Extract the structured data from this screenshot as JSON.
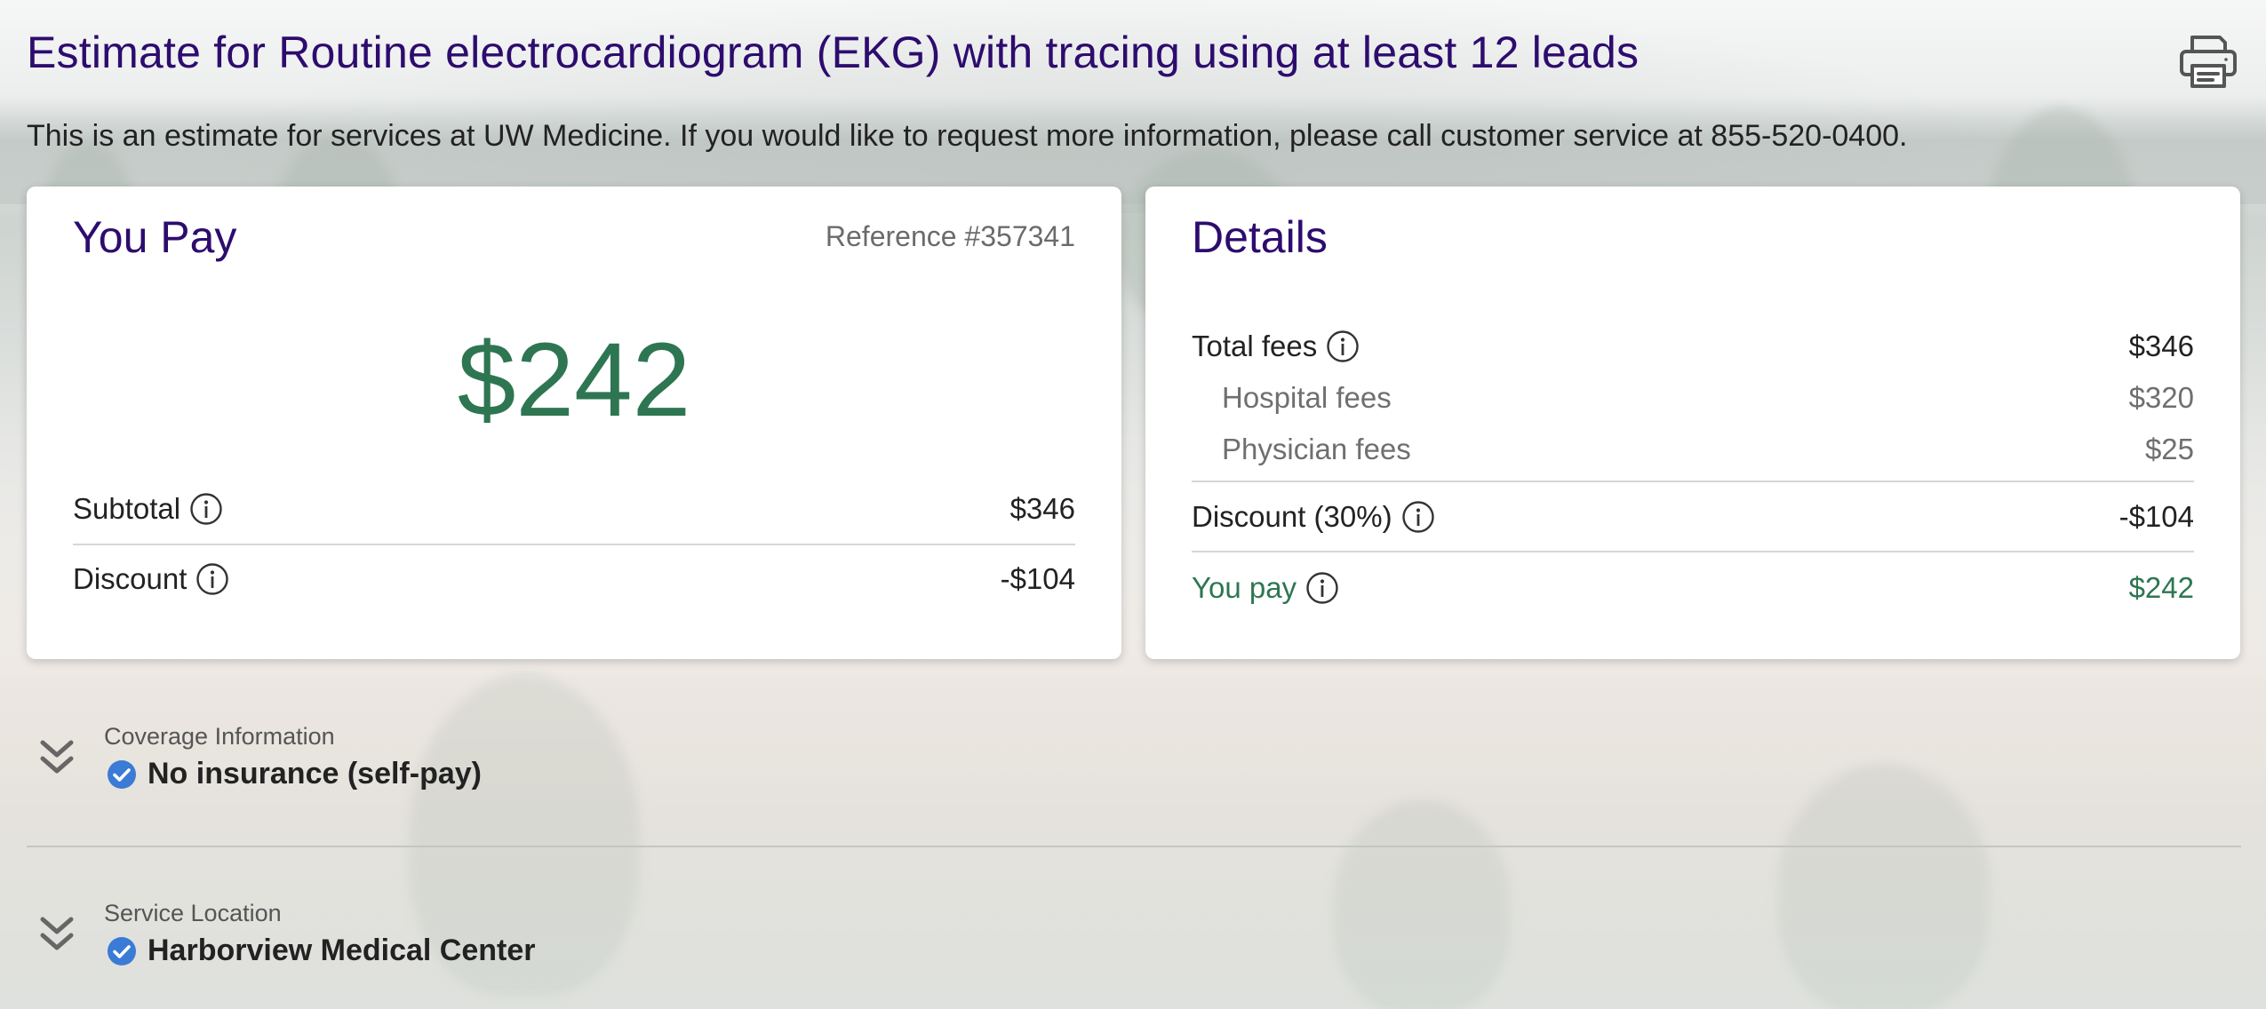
{
  "page": {
    "title": "Estimate for Routine electrocardiogram (EKG) with tracing using at least 12 leads",
    "intro": "This is an estimate for services at UW Medicine. If you would like to request more information, please call customer service at 855-520-0400.",
    "print_icon": "printer-icon"
  },
  "you_pay": {
    "heading": "You Pay",
    "reference": "Reference #357341",
    "amount": "$242",
    "rows": [
      {
        "label": "Subtotal",
        "value": "$346"
      },
      {
        "label": "Discount",
        "value": "-$104"
      }
    ]
  },
  "details": {
    "heading": "Details",
    "total_fees": {
      "label": "Total fees",
      "value": "$346"
    },
    "hospital_fees": {
      "label": "Hospital fees",
      "value": "$320"
    },
    "physician_fees": {
      "label": "Physician fees",
      "value": "$25"
    },
    "discount": {
      "label": "Discount (30%)",
      "value": "-$104"
    },
    "you_pay": {
      "label": "You pay",
      "value": "$242"
    }
  },
  "coverage": {
    "label": "Coverage Information",
    "value": "No insurance (self-pay)"
  },
  "location": {
    "label": "Service Location",
    "value": "Harborview Medical Center"
  },
  "colors": {
    "brand_purple": "#2d0c6e",
    "amount_green": "#2e7652",
    "check_blue": "#3a7bd5"
  }
}
